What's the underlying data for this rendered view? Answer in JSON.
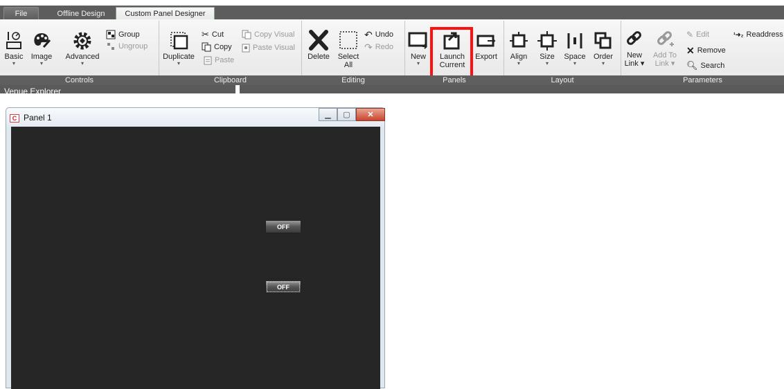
{
  "tabs": {
    "file": "File",
    "offline": "Offline Design",
    "custom": "Custom Panel Designer"
  },
  "controls": {
    "basic": "Basic",
    "image": "Image",
    "advanced": "Advanced",
    "group": "Group",
    "ungroup": "Ungroup",
    "label": "Controls"
  },
  "clipboard": {
    "duplicate": "Duplicate",
    "cut": "Cut",
    "copy": "Copy",
    "paste": "Paste",
    "copy_visual": "Copy Visual",
    "paste_visual": "Paste Visual",
    "label": "Clipboard"
  },
  "editing": {
    "delete": "Delete",
    "select_all_1": "Select",
    "select_all_2": "All",
    "undo": "Undo",
    "redo": "Redo",
    "label": "Editing"
  },
  "panels": {
    "new": "New",
    "launch_1": "Launch",
    "launch_2": "Current",
    "export": "Export",
    "label": "Panels"
  },
  "layout": {
    "align": "Align",
    "size": "Size",
    "space": "Space",
    "order": "Order",
    "label": "Layout"
  },
  "parameters": {
    "new_link_1": "New",
    "new_link_2": "Link",
    "add_to_1": "Add To",
    "add_to_2": "Link",
    "edit": "Edit",
    "remove": "Remove",
    "search": "Search",
    "readdress": "Readdress",
    "label": "Parameters"
  },
  "venue": {
    "header": "Venue Explorer"
  },
  "panel_window": {
    "title": "Panel 1",
    "icon_letter": "C",
    "toggle1": "OFF",
    "toggle2": "OFF"
  },
  "colors": {
    "highlight": "#ff1010",
    "canvas": "#262626",
    "tab_active_border": "#8aa18a"
  }
}
